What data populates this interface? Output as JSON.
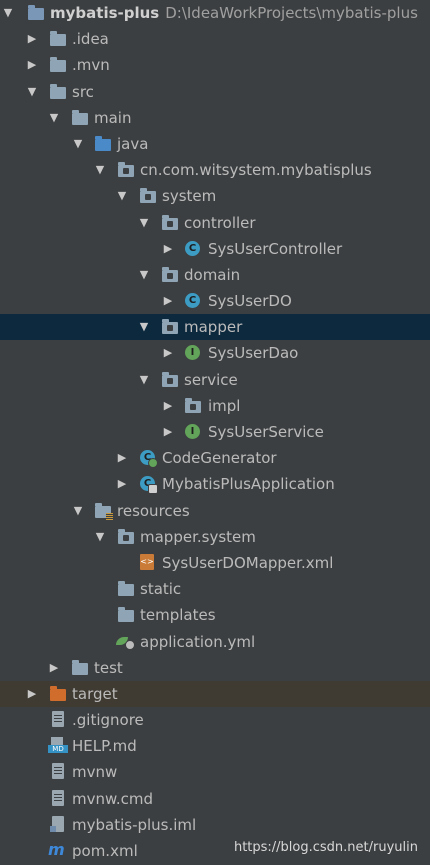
{
  "project": {
    "name": "mybatis-plus",
    "path": "D:\\IdeaWorkProjects\\mybatis-plus"
  },
  "tree": [
    {
      "label": ".idea",
      "icon": "folder-icon"
    },
    {
      "label": ".mvn",
      "icon": "folder-icon"
    },
    {
      "label": "src",
      "icon": "folder-icon"
    },
    {
      "label": "main",
      "icon": "folder-icon"
    },
    {
      "label": "java",
      "icon": "source-folder-icon"
    },
    {
      "label": "cn.com.witsystem.mybatisplus",
      "icon": "package-icon"
    },
    {
      "label": "system",
      "icon": "package-icon"
    },
    {
      "label": "controller",
      "icon": "package-icon"
    },
    {
      "label": "SysUserController",
      "icon": "class-icon",
      "glyph": "C"
    },
    {
      "label": "domain",
      "icon": "package-icon"
    },
    {
      "label": "SysUserDO",
      "icon": "class-icon",
      "glyph": "C"
    },
    {
      "label": "mapper",
      "icon": "package-icon",
      "selected": true
    },
    {
      "label": "SysUserDao",
      "icon": "interface-icon",
      "glyph": "I"
    },
    {
      "label": "service",
      "icon": "package-icon"
    },
    {
      "label": "impl",
      "icon": "package-icon"
    },
    {
      "label": "SysUserService",
      "icon": "interface-icon",
      "glyph": "I"
    },
    {
      "label": "CodeGenerator",
      "icon": "runnable-class-icon",
      "glyph": "C"
    },
    {
      "label": "MybatisPlusApplication",
      "icon": "spring-boot-class-icon",
      "glyph": "C"
    },
    {
      "label": "resources",
      "icon": "resources-folder-icon"
    },
    {
      "label": "mapper.system",
      "icon": "package-icon"
    },
    {
      "label": "SysUserDOMapper.xml",
      "icon": "xml-file-icon",
      "glyph": "<>"
    },
    {
      "label": "static",
      "icon": "folder-icon"
    },
    {
      "label": "templates",
      "icon": "folder-icon"
    },
    {
      "label": "application.yml",
      "icon": "spring-yml-icon"
    },
    {
      "label": "test",
      "icon": "folder-icon"
    },
    {
      "label": "target",
      "icon": "excluded-folder-icon"
    },
    {
      "label": ".gitignore",
      "icon": "text-file-icon"
    },
    {
      "label": "HELP.md",
      "icon": "markdown-file-icon",
      "glyph": "MD"
    },
    {
      "label": "mvnw",
      "icon": "text-file-icon"
    },
    {
      "label": "mvnw.cmd",
      "icon": "text-file-icon"
    },
    {
      "label": "mybatis-plus.iml",
      "icon": "module-file-icon"
    },
    {
      "label": "pom.xml",
      "icon": "maven-icon",
      "glyph": "m"
    }
  ],
  "watermark": "https://blog.csdn.net/ruyulin",
  "colors": {
    "background": "#3c3f41",
    "selection": "#0d293e",
    "excluded_row": "#3f3a32",
    "text": "#bbbbbb"
  }
}
